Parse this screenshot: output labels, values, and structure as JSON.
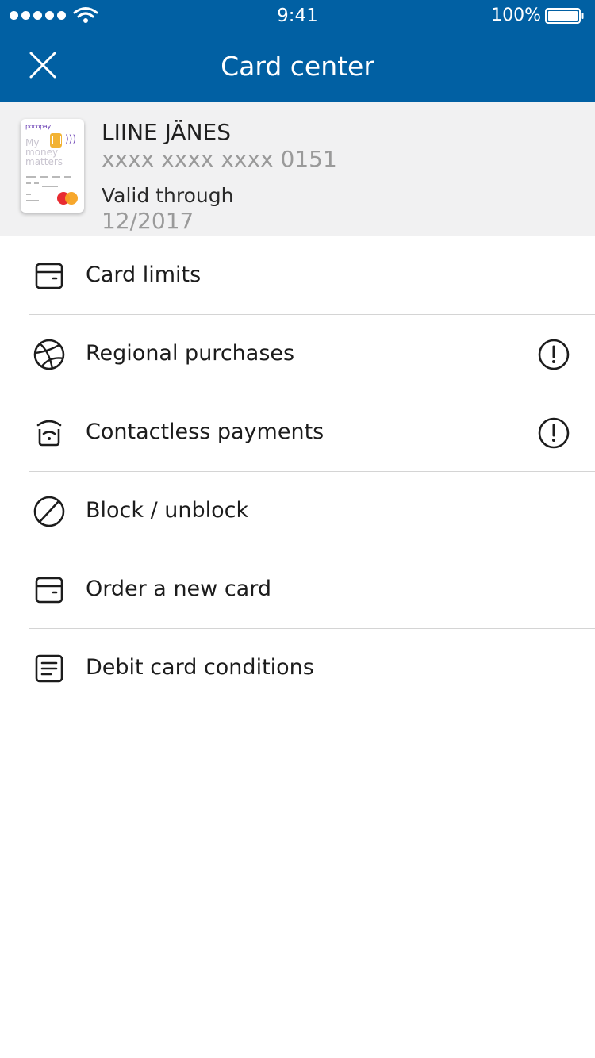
{
  "status_bar": {
    "time": "9:41",
    "battery": "100%",
    "signal_icon": "signal-dots-icon",
    "wifi_icon": "wifi-icon",
    "battery_icon": "battery-icon"
  },
  "nav": {
    "title": "Card center",
    "close_icon": "close-icon"
  },
  "card": {
    "holder": "LIINE JÄNES",
    "number": "xxxx xxxx xxxx 0151",
    "valid_label": "Valid through",
    "valid_date": "12/2017",
    "thumbnail": {
      "brand": "pocopay",
      "tagline": "My money matters"
    }
  },
  "menu": {
    "items": [
      {
        "label": "Card limits",
        "icon": "card-icon",
        "warning": false
      },
      {
        "label": "Regional purchases",
        "icon": "globe-icon",
        "warning": true
      },
      {
        "label": "Contactless payments",
        "icon": "contactless-icon",
        "warning": true
      },
      {
        "label": "Block / unblock",
        "icon": "block-icon",
        "warning": false
      },
      {
        "label": "Order a new card",
        "icon": "card-icon",
        "warning": false
      },
      {
        "label": "Debit card conditions",
        "icon": "document-icon",
        "warning": false
      }
    ],
    "warning_icon": "alert-icon"
  },
  "colors": {
    "header_bg": "#0160a3",
    "card_header_bg": "#f1f1f2",
    "divider": "#d4d4d4",
    "muted_text": "#9a9a9a"
  }
}
